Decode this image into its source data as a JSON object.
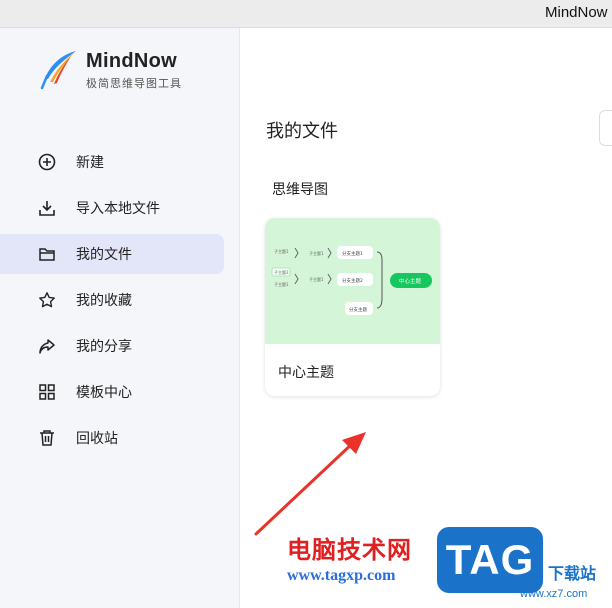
{
  "window": {
    "title": "MindNow"
  },
  "brand": {
    "name": "MindNow",
    "tagline": "极简思维导图工具"
  },
  "sidebar": {
    "items": [
      {
        "label": "新建",
        "icon": "plus-circle-icon"
      },
      {
        "label": "导入本地文件",
        "icon": "download-icon"
      },
      {
        "label": "我的文件",
        "icon": "folder-icon",
        "active": true
      },
      {
        "label": "我的收藏",
        "icon": "star-icon"
      },
      {
        "label": "我的分享",
        "icon": "share-icon"
      },
      {
        "label": "模板中心",
        "icon": "grid-icon"
      },
      {
        "label": "回收站",
        "icon": "trash-icon"
      }
    ]
  },
  "main": {
    "title": "我的文件",
    "section": "思维导图",
    "files": [
      {
        "title": "中心主题",
        "thumb": {
          "center": "中心主题",
          "subtopics": [
            "分支主题1",
            "分支主题2",
            "分支主题"
          ],
          "leaves": [
            "子主题1",
            "子主题2"
          ]
        }
      }
    ]
  },
  "watermark": {
    "cn": "电脑技术网",
    "url": "www.tagxp.com",
    "tag": "TAG",
    "site": "下载站",
    "site_url": "www.xz7.com"
  },
  "colors": {
    "accent": "#16c75f",
    "active_bg": "#e3e5f8",
    "thumb_bg": "#d4f5d8",
    "watermark_red": "#e02020",
    "watermark_blue": "#1b73c9"
  }
}
